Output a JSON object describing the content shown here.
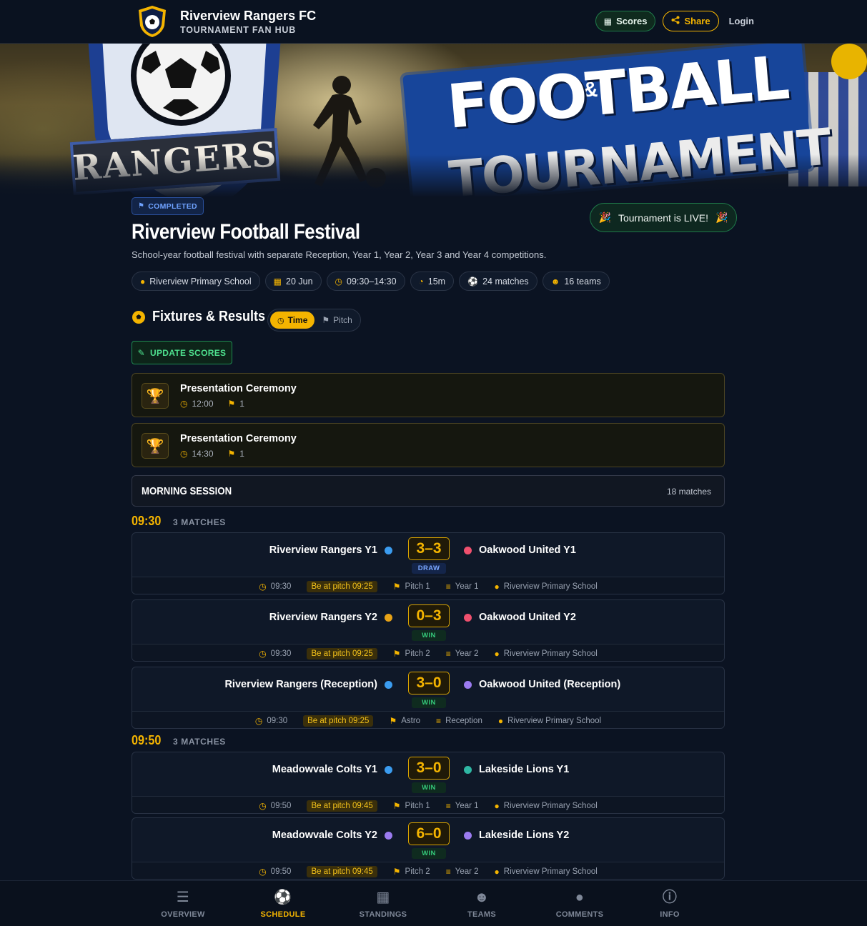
{
  "header": {
    "title": "Riverview Rangers FC",
    "subtitle": "TOURNAMENT FAN HUB",
    "scores_label": "Scores",
    "share_label": "Share",
    "login_label": "Login"
  },
  "banner": {
    "crest_text": "RANGERS",
    "amp": "&",
    "line1": "FOOTBALL",
    "line2": "TOURNAMENT"
  },
  "event": {
    "status": "COMPLETED",
    "live_label": "Tournament is LIVE!",
    "title": "Riverview Football Festival",
    "description": "School-year football festival with separate Reception, Year 1, Year 2, Year 3 and Year 4 competitions.",
    "chips": {
      "venue": "Riverview Primary School",
      "date": "20 Jun",
      "time": "09:30–14:30",
      "duration": "15m",
      "matches": "24 matches",
      "teams": "16 teams"
    }
  },
  "fixtures": {
    "title": "Fixtures & Results",
    "toggle_time": "Time",
    "toggle_pitch": "Pitch",
    "update_label": "UPDATE SCORES"
  },
  "ceremonies": [
    {
      "title": "Presentation Ceremony",
      "time": "12:00",
      "pitch": "1"
    },
    {
      "title": "Presentation Ceremony",
      "time": "14:30",
      "pitch": "1"
    }
  ],
  "session": {
    "title": "MORNING SESSION",
    "count": "18 matches"
  },
  "slots": [
    {
      "time": "09:30",
      "count": "3 MATCHES"
    },
    {
      "time": "09:50",
      "count": "3 MATCHES"
    }
  ],
  "matches": [
    {
      "home": "Riverview Rangers Y1",
      "home_color": "#3b9cf0",
      "score": "3–3",
      "result": "DRAW",
      "away": "Oakwood United Y1",
      "away_color": "#f0506e",
      "time": "09:30",
      "be_at": "Be at pitch 09:25",
      "pitch": "Pitch 1",
      "group": "Year 1",
      "venue": "Riverview Primary School"
    },
    {
      "home": "Riverview Rangers Y2",
      "home_color": "#e8a317",
      "score": "0–3",
      "result": "WIN",
      "away": "Oakwood United Y2",
      "away_color": "#f0506e",
      "time": "09:30",
      "be_at": "Be at pitch 09:25",
      "pitch": "Pitch 2",
      "group": "Year 2",
      "venue": "Riverview Primary School"
    },
    {
      "home": "Riverview Rangers (Reception)",
      "home_color": "#3b9cf0",
      "score": "3–0",
      "result": "WIN",
      "away": "Oakwood United (Reception)",
      "away_color": "#9b7bf0",
      "time": "09:30",
      "be_at": "Be at pitch 09:25",
      "pitch": "Astro",
      "group": "Reception",
      "venue": "Riverview Primary School"
    },
    {
      "home": "Meadowvale Colts Y1",
      "home_color": "#3b9cf0",
      "score": "3–0",
      "result": "WIN",
      "away": "Lakeside Lions Y1",
      "away_color": "#2fb7a4",
      "time": "09:50",
      "be_at": "Be at pitch 09:45",
      "pitch": "Pitch 1",
      "group": "Year 1",
      "venue": "Riverview Primary School"
    },
    {
      "home": "Meadowvale Colts Y2",
      "home_color": "#9b7bf0",
      "score": "6–0",
      "result": "WIN",
      "away": "Lakeside Lions Y2",
      "away_color": "#9b7bf0",
      "time": "09:50",
      "be_at": "Be at pitch 09:45",
      "pitch": "Pitch 2",
      "group": "Year 2",
      "venue": "Riverview Primary School"
    }
  ],
  "nav": [
    {
      "label": "OVERVIEW",
      "icon": "checklist-icon"
    },
    {
      "label": "SCHEDULE",
      "icon": "football-icon",
      "active": true
    },
    {
      "label": "STANDINGS",
      "icon": "table-icon"
    },
    {
      "label": "TEAMS",
      "icon": "users-icon"
    },
    {
      "label": "COMMENTS",
      "icon": "chat-icon"
    },
    {
      "label": "INFO",
      "icon": "info-icon"
    }
  ]
}
